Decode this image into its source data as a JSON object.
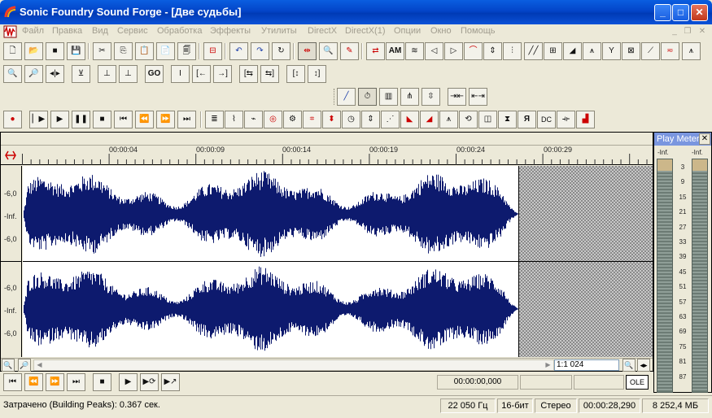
{
  "window": {
    "title": "Sonic Foundry Sound Forge - [Две судьбы]",
    "minimize_label": "_",
    "maximize_label": "□",
    "close_label": "✕"
  },
  "menu": {
    "items": [
      "Файл",
      "Правка",
      "Вид",
      "Сервис",
      "Обработка",
      "Эффекты",
      "Утилиты",
      "DirectX",
      "DirectX(1)",
      "Опции",
      "Окно",
      "Помощь"
    ],
    "mdi_minimize": "_",
    "mdi_restore": "❐",
    "mdi_close": "✕"
  },
  "toolbar": {
    "go_label": "GO",
    "am_label": "AM",
    "dc_label": "DC",
    "ya_label": "Я"
  },
  "timeline": {
    "labels": [
      "00:00:04",
      "00:00:09",
      "00:00:14",
      "00:00:19",
      "00:00:24",
      "00:00:29"
    ]
  },
  "channel_scale": {
    "left": [
      "-6,0",
      "-Inf.",
      "-6,0"
    ],
    "right": [
      "-6,0",
      "-Inf.",
      "-6,0"
    ]
  },
  "zoom": {
    "ratio": "1:1 024"
  },
  "transport": {
    "selection_time": "00:00:00,000",
    "ole_label": "OLE"
  },
  "meter": {
    "title": "Play Meter",
    "peak_left": "-Inf.",
    "peak_right": "-Inf.",
    "scale": [
      "3",
      "9",
      "15",
      "21",
      "27",
      "33",
      "39",
      "45",
      "51",
      "57",
      "63",
      "69",
      "75",
      "81",
      "87"
    ]
  },
  "status": {
    "message": "Затрачено (Building Peaks): 0.367 сек.",
    "sample_rate": "22 050 Гц",
    "bit_depth": "16-бит",
    "channels": "Стерео",
    "length": "00:00:28,290",
    "disk_space": "8 252,4 МБ"
  },
  "colors": {
    "waveform": "#0d1a6e",
    "titlebar": "#0344c8",
    "background": "#ece9d8"
  }
}
